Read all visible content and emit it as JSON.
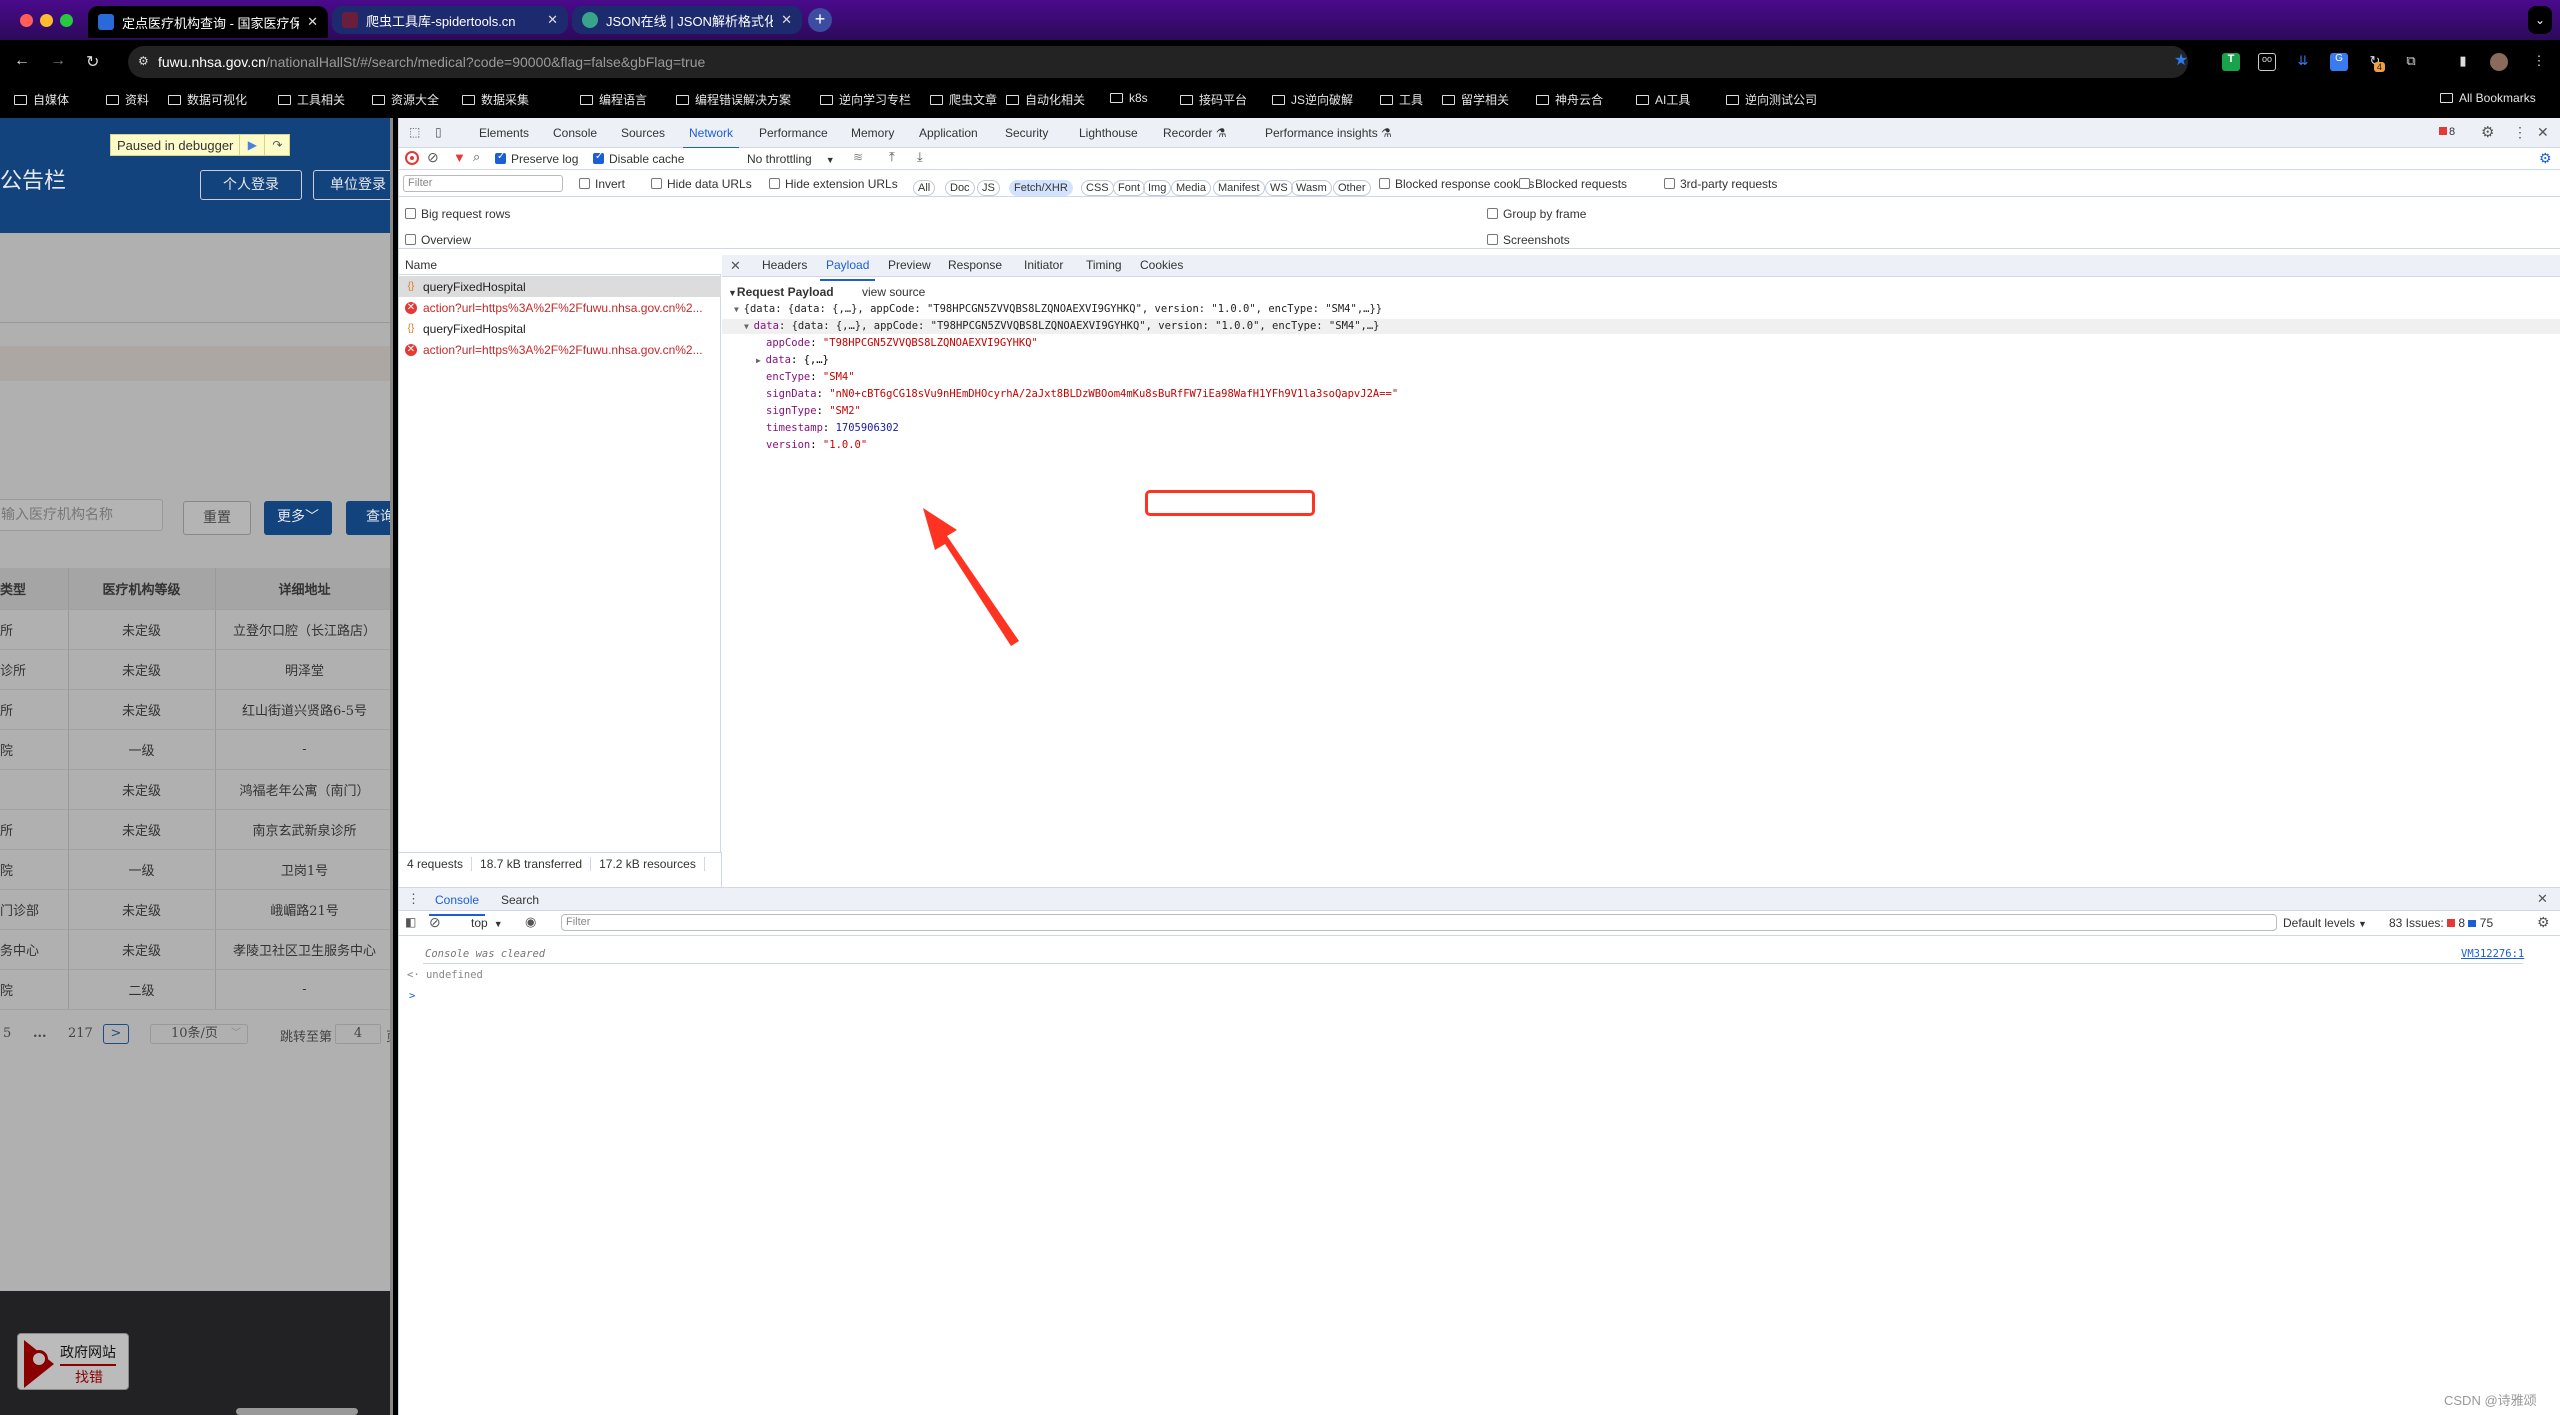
{
  "browser": {
    "tabs": [
      {
        "label": "定点医疗机构查询 - 国家医疗保",
        "active": true
      },
      {
        "label": "爬虫工具库-spidertools.cn",
        "active": false
      },
      {
        "label": "JSON在线 | JSON解析格式化-",
        "active": false
      }
    ],
    "new_tab": "+",
    "tab_menu": "⌄",
    "url_host": "fuwu.nhsa.gov.cn",
    "url_path": "/nationalHallSt/#/search/medical?code=90000&flag=false&gbFlag=true",
    "extension_badge": "4",
    "bookmarks": [
      "自媒体",
      "资料",
      "数据可视化",
      "工具相关",
      "资源大全",
      "数据采集",
      "编程语言",
      "编程错误解决方案",
      "逆向学习专栏",
      "爬虫文章",
      "自动化相关",
      "k8s",
      "接码平台",
      "JS逆向破解",
      "工具",
      "留学相关",
      "神舟云合",
      "AI工具",
      "逆向测试公司"
    ],
    "all_bookmarks": "All Bookmarks"
  },
  "page": {
    "debugger_banner": "Paused in debugger",
    "notice": "公告栏",
    "personal_login": "个人登录",
    "unit_login": "单位登录",
    "search_placeholder": "输入医疗机构名称",
    "reset_button": "重置",
    "more_button": "更多",
    "query_button": "查询",
    "table": {
      "headers": [
        "类型",
        "医疗机构等级",
        "详细地址"
      ],
      "rows": [
        [
          "所",
          "未定级",
          "立登尔口腔（长江路店）"
        ],
        [
          "诊所",
          "未定级",
          "明泽堂"
        ],
        [
          "所",
          "未定级",
          "红山街道兴贤路6-5号"
        ],
        [
          "院",
          "一级",
          "-"
        ],
        [
          "",
          "未定级",
          "鸿福老年公寓（南门）"
        ],
        [
          "所",
          "未定级",
          "南京玄武新泉诊所"
        ],
        [
          "院",
          "一级",
          "卫岗1号"
        ],
        [
          "门诊部",
          "未定级",
          "峨嵋路21号"
        ],
        [
          "务中心",
          "未定级",
          "孝陵卫社区卫生服务中心"
        ],
        [
          "院",
          "二级",
          "-"
        ]
      ]
    },
    "pager": {
      "page5": "5",
      "ellipsis": "...",
      "last": "217",
      "next": ">",
      "page_size": "10条/页",
      "jump_label": "跳转至第",
      "jump_value": "4",
      "page_suffix": "页"
    },
    "gov_badge_top": "政府网站",
    "gov_badge_bottom": "找错"
  },
  "devtools": {
    "tabs": [
      "Elements",
      "Console",
      "Sources",
      "Network",
      "Performance",
      "Memory",
      "Application",
      "Security",
      "Lighthouse",
      "Recorder ⚗",
      "Performance insights ⚗"
    ],
    "active_tab": "Network",
    "error_count": "8",
    "toolbar": {
      "preserve_log": "Preserve log",
      "disable_cache": "Disable cache",
      "throttling": "No throttling"
    },
    "filter_placeholder": "Filter",
    "filter_opts": {
      "invert": "Invert",
      "hide_data_urls": "Hide data URLs",
      "hide_ext_urls": "Hide extension URLs"
    },
    "type_chips": [
      "All",
      "Doc",
      "JS",
      "Fetch/XHR",
      "CSS",
      "Font",
      "Img",
      "Media",
      "Manifest",
      "WS",
      "Wasm",
      "Other"
    ],
    "active_chip": "Fetch/XHR",
    "blocked_opts": [
      "Blocked response cookies",
      "Blocked requests",
      "3rd-party requests"
    ],
    "settings": {
      "big_rows": "Big request rows",
      "overview": "Overview",
      "group_by_frame": "Group by frame",
      "screenshots": "Screenshots"
    },
    "name_header": "Name",
    "requests": [
      {
        "name": "queryFixedHospital",
        "type": "xhr",
        "selected": true
      },
      {
        "name": "action?url=https%3A%2F%2Ffuwu.nhsa.gov.cn%2...",
        "type": "error"
      },
      {
        "name": "queryFixedHospital",
        "type": "xhr"
      },
      {
        "name": "action?url=https%3A%2F%2Ffuwu.nhsa.gov.cn%2...",
        "type": "error"
      }
    ],
    "detail_tabs": [
      "Headers",
      "Payload",
      "Preview",
      "Response",
      "Initiator",
      "Timing",
      "Cookies"
    ],
    "active_detail_tab": "Payload",
    "payload": {
      "section_title": "Request Payload",
      "view_source": "view source",
      "root_summary": "{data: {data: {,…}, appCode: \"T98HPCGN5ZVVQBS8LZQNOAEXVI9GYHKQ\", version: \"1.0.0\", encType: \"SM4\",…}}",
      "data_key": "data",
      "data_summary": "{data: {,…}, appCode: \"T98HPCGN5ZVVQBS8LZQNOAEXVI9GYHKQ\", version: \"1.0.0\", encType: \"SM4\",…}",
      "fields": [
        {
          "key": "appCode",
          "value": "\"T98HPCGN5ZVVQBS8LZQNOAEXVI9GYHKQ\"",
          "kind": "string"
        },
        {
          "key": "data",
          "value": "{,…}",
          "kind": "object"
        },
        {
          "key": "encType",
          "value": "\"SM4\"",
          "kind": "string"
        },
        {
          "key": "signData",
          "value": "\"nN0+cBT6gCG18sVu9nHEmDHOcyrhA/2aJxt8BLDzWBOom4mKu8sBuRfFW7iEa98WafH1YFh9V1la3soQapvJ2A==\"",
          "kind": "string"
        },
        {
          "key": "signType",
          "value": "\"SM2\"",
          "kind": "string"
        },
        {
          "key": "timestamp",
          "value": "1705906302",
          "kind": "number"
        },
        {
          "key": "version",
          "value": "\"1.0.0\"",
          "kind": "string"
        }
      ]
    },
    "status": {
      "requests": "4 requests",
      "transferred": "18.7 kB transferred",
      "resources": "17.2 kB resources"
    },
    "drawer_tabs": [
      "Console",
      "Search"
    ],
    "console": {
      "context": "top",
      "filter_placeholder": "Filter",
      "levels": "Default levels",
      "issues_label": "83 Issues:",
      "issues_errors": "8",
      "issues_info": "75",
      "messages": [
        {
          "text": "Console was cleared",
          "source": "VM312276:1"
        },
        {
          "text": "undefined",
          "prefix": "<·"
        }
      ],
      "prompt": ">"
    }
  },
  "watermark": "CSDN @诗雅颂"
}
